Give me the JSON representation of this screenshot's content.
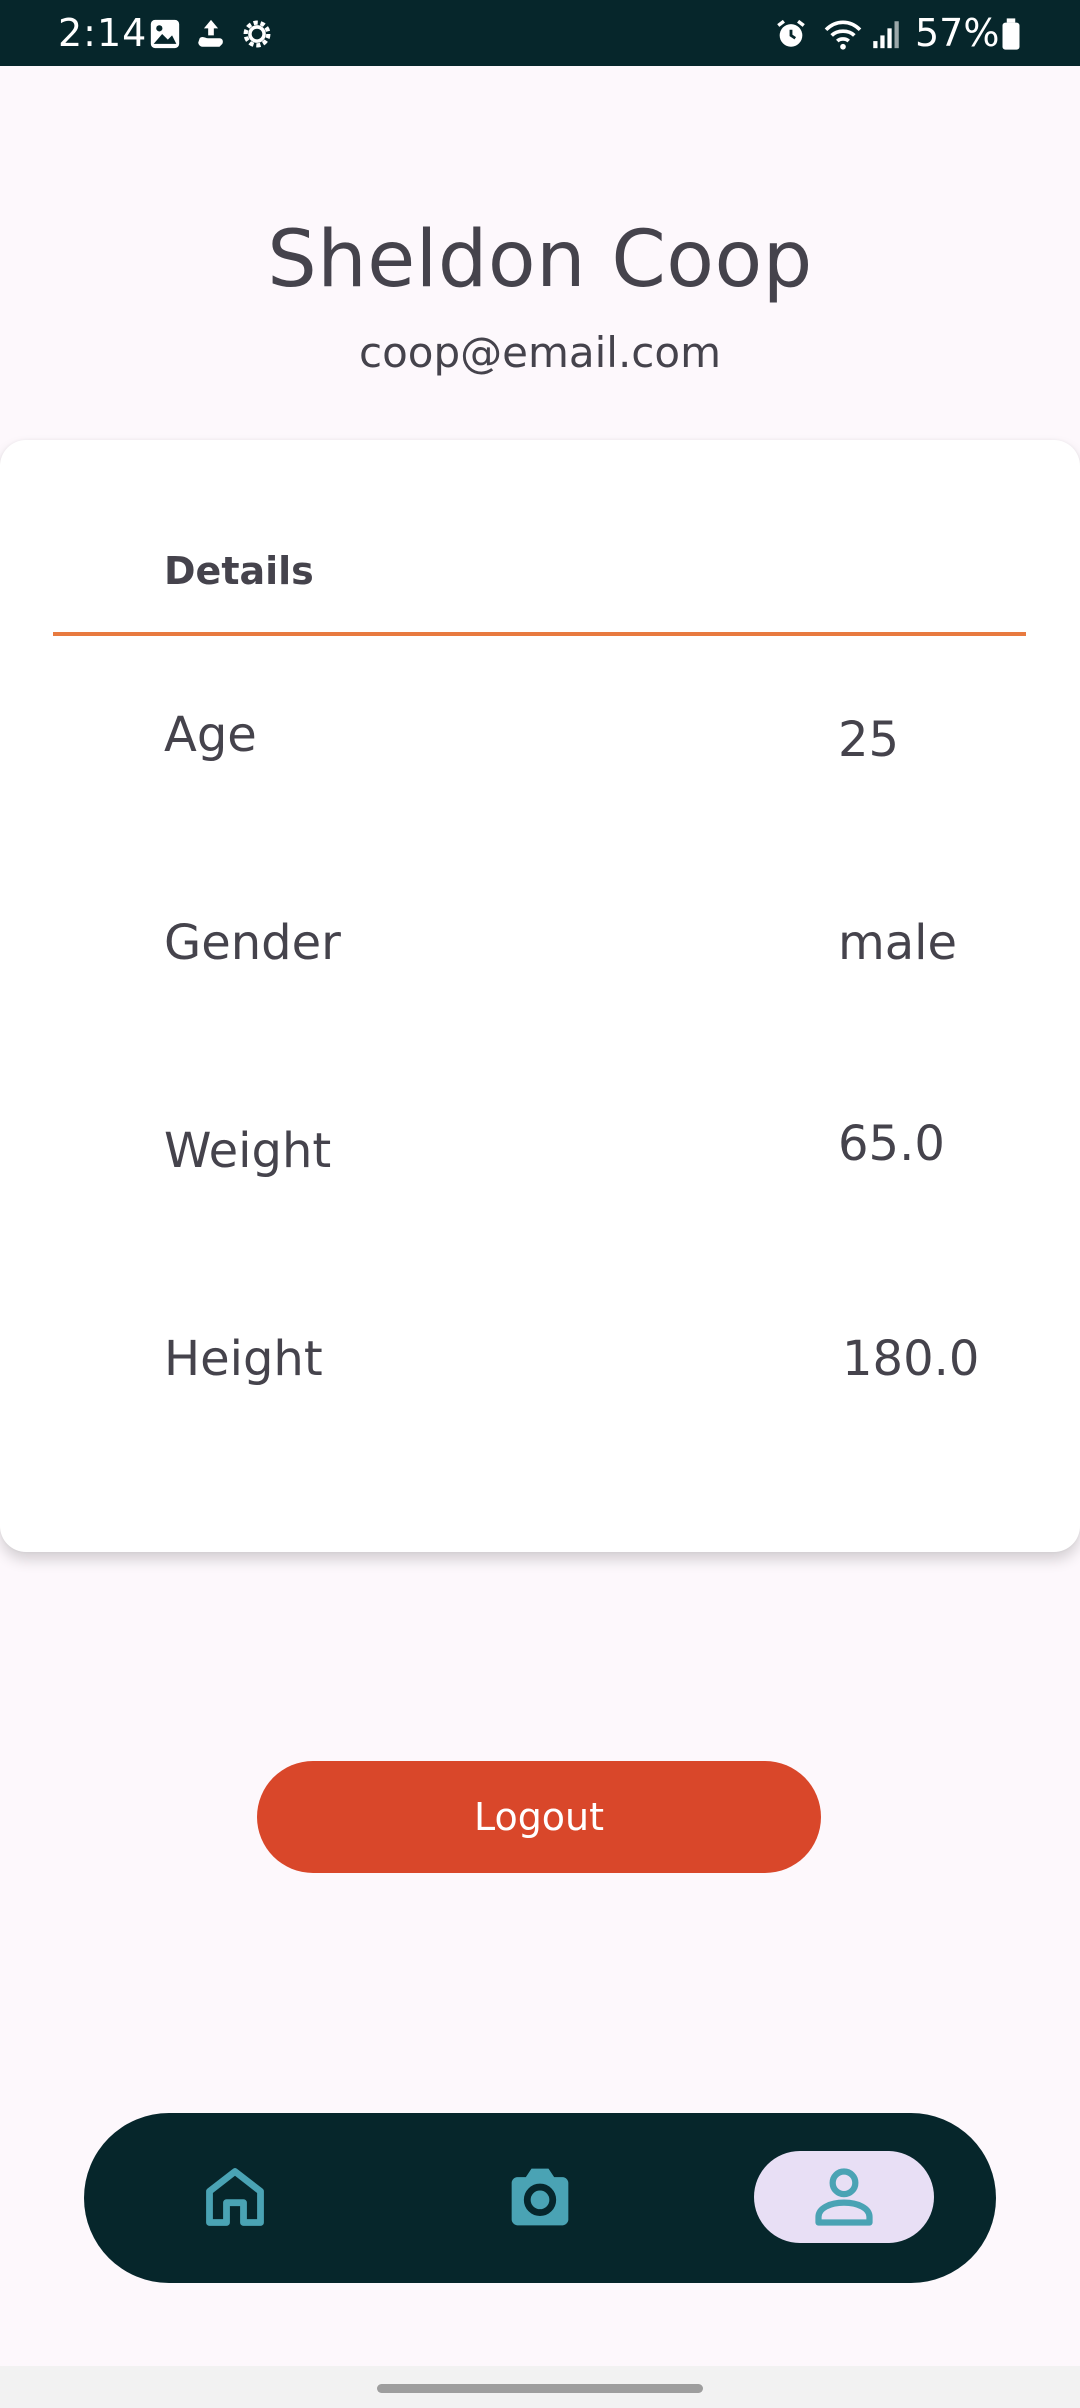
{
  "status_bar": {
    "time": "2:14",
    "battery": "57%",
    "left_icons": [
      "gallery-icon",
      "upload-icon",
      "settings-icon"
    ],
    "right_icons": [
      "alarm-icon",
      "wifi-icon",
      "signal-icon",
      "battery-icon"
    ]
  },
  "profile": {
    "name": "Sheldon Coop",
    "email": "coop@email.com"
  },
  "details": {
    "tab_label": "Details",
    "accent_color": "#e87a3f",
    "rows": [
      {
        "label": "Age",
        "value": "25"
      },
      {
        "label": "Gender",
        "value": "male"
      },
      {
        "label": "Weight",
        "value": "65.0"
      },
      {
        "label": "Height",
        "value": "180.0"
      }
    ]
  },
  "logout": {
    "label": "Logout",
    "color": "#d9472a"
  },
  "bottom_nav": {
    "items": [
      {
        "name": "home",
        "icon": "home-icon",
        "active": false
      },
      {
        "name": "camera",
        "icon": "camera-icon",
        "active": false
      },
      {
        "name": "profile",
        "icon": "person-icon",
        "active": true
      }
    ],
    "background": "#06262b",
    "icon_color": "#4aa3b4",
    "active_pill_color": "#e8dff5"
  }
}
